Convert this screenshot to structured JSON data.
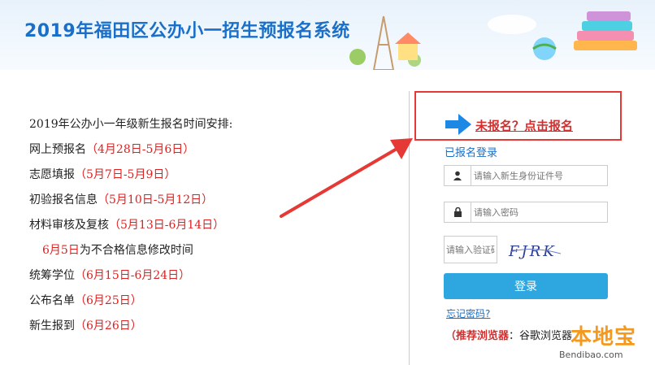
{
  "header": {
    "title": "2019年福田区公办小一招生预报名系统"
  },
  "schedule": {
    "heading": "2019年公办小一年级新生报名时间安排:",
    "items": [
      {
        "label": "网上预报名",
        "date": "（4月28日-5月6日）"
      },
      {
        "label": "志愿填报",
        "date": "（5月7日-5月9日）"
      },
      {
        "label": "初验报名信息",
        "date": "（5月10日-5月12日）"
      },
      {
        "label": "材料审核及复核",
        "date": "（5月13日-6月14日）"
      }
    ],
    "note_date": "6月5日",
    "note_text": "为不合格信息修改时间",
    "items2": [
      {
        "label": "统筹学位",
        "date": "（6月15日-6月24日）"
      },
      {
        "label": "公布名单",
        "date": "（6月25日）"
      },
      {
        "label": "新生报到",
        "date": "（6月26日）"
      }
    ]
  },
  "register": {
    "link": "未报名？点击报名"
  },
  "login": {
    "title": "已报名登录",
    "id_placeholder": "请输入新生身份证件号",
    "password_placeholder": "请输入密码",
    "captcha_placeholder": "请输入验证码",
    "captcha_text": "FJRK",
    "submit": "登录",
    "forgot": "忘记密码?",
    "browser_label": "（推荐浏览器",
    "browser_value": "：谷歌浏览器"
  },
  "watermark": {
    "main": "本地宝",
    "sub": "Bendibao.com"
  },
  "colors": {
    "brand_blue": "#1a6fc8",
    "button_blue": "#2ea7e0",
    "highlight_red": "#e53935"
  }
}
